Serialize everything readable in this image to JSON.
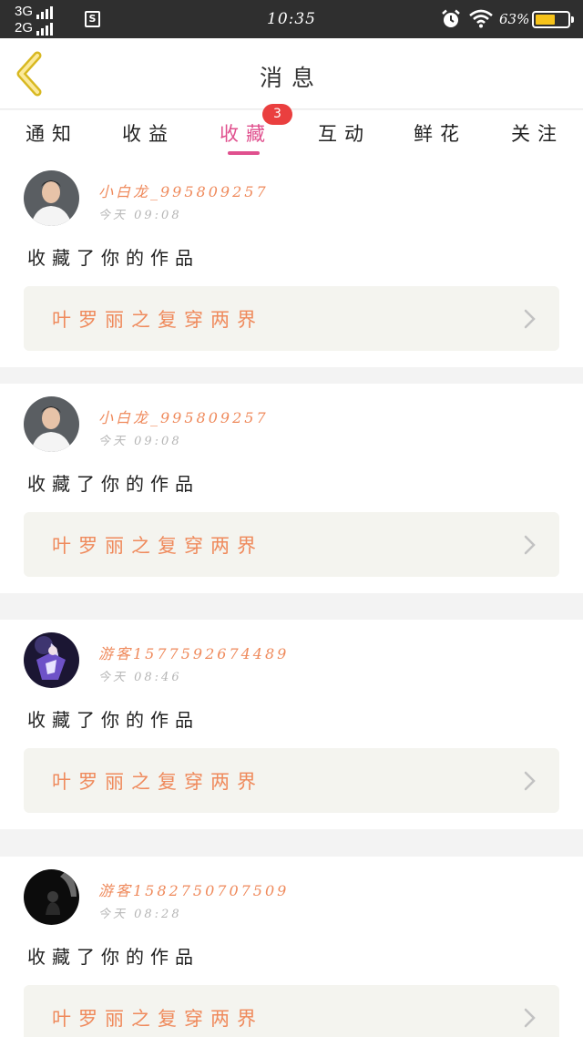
{
  "status_bar": {
    "network_top": "3G",
    "network_bottom": "2G",
    "sim_label": "S",
    "time": "10:35",
    "battery_percent": "63%",
    "battery_level": 0.63,
    "battery_color": "#f6c31a"
  },
  "header": {
    "title": "消息",
    "back_icon": "chevron-left-icon"
  },
  "tabs": [
    {
      "label": "通知",
      "active": false
    },
    {
      "label": "收益",
      "active": false
    },
    {
      "label": "收藏",
      "active": true,
      "badge": "3"
    },
    {
      "label": "互动",
      "active": false
    },
    {
      "label": "鲜花",
      "active": false
    },
    {
      "label": "关注",
      "active": false
    }
  ],
  "colors": {
    "accent": "#e0508e",
    "badge": "#ea3f3f",
    "name": "#ef8a5c"
  },
  "items": [
    {
      "user": "小白龙_995809257",
      "time": "今天 09:08",
      "action": "收藏了你的作品",
      "work": "叶罗丽之复穿两界",
      "avatar": "young-man-white-shirt"
    },
    {
      "user": "小白龙_995809257",
      "time": "今天 09:08",
      "action": "收藏了你的作品",
      "work": "叶罗丽之复穿两界",
      "avatar": "young-man-white-shirt"
    },
    {
      "user": "游客1577592674489",
      "time": "今天 08:46",
      "action": "收藏了你的作品",
      "work": "叶罗丽之复穿两界",
      "avatar": "anime-character"
    },
    {
      "user": "游客1582750707509",
      "time": "今天 08:28",
      "action": "收藏了你的作品",
      "work": "叶罗丽之复穿两界",
      "avatar": "dark-silhouette"
    }
  ]
}
